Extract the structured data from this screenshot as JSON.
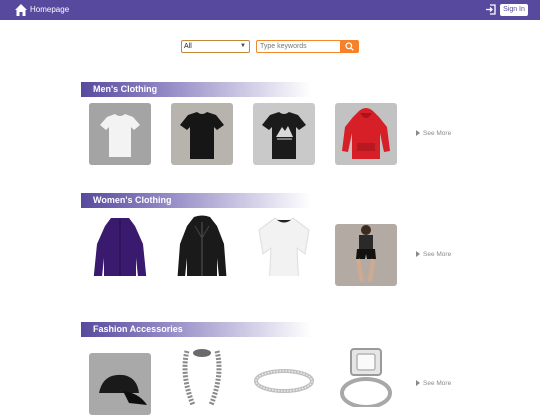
{
  "header": {
    "home_label": "Homepage",
    "signin_label": "Sign In"
  },
  "search": {
    "category": "All",
    "placeholder": "Type keywords"
  },
  "sections": [
    {
      "title": "Men's Clothing",
      "see_more": "See More",
      "items": [
        "white-tshirt",
        "black-tshirt",
        "printed-tshirt",
        "red-hoodie"
      ]
    },
    {
      "title": "Women's Clothing",
      "see_more": "See More",
      "items": [
        "purple-jacket",
        "leather-jacket",
        "white-top",
        "black-shorts-outfit"
      ]
    },
    {
      "title": "Fashion Accessories",
      "see_more": "See More",
      "items": [
        "black-cap",
        "chain-bracelet",
        "diamond-bangle",
        "diamond-ring"
      ]
    }
  ],
  "colors": {
    "brand": "#574a9e",
    "accent": "#f5822a"
  }
}
